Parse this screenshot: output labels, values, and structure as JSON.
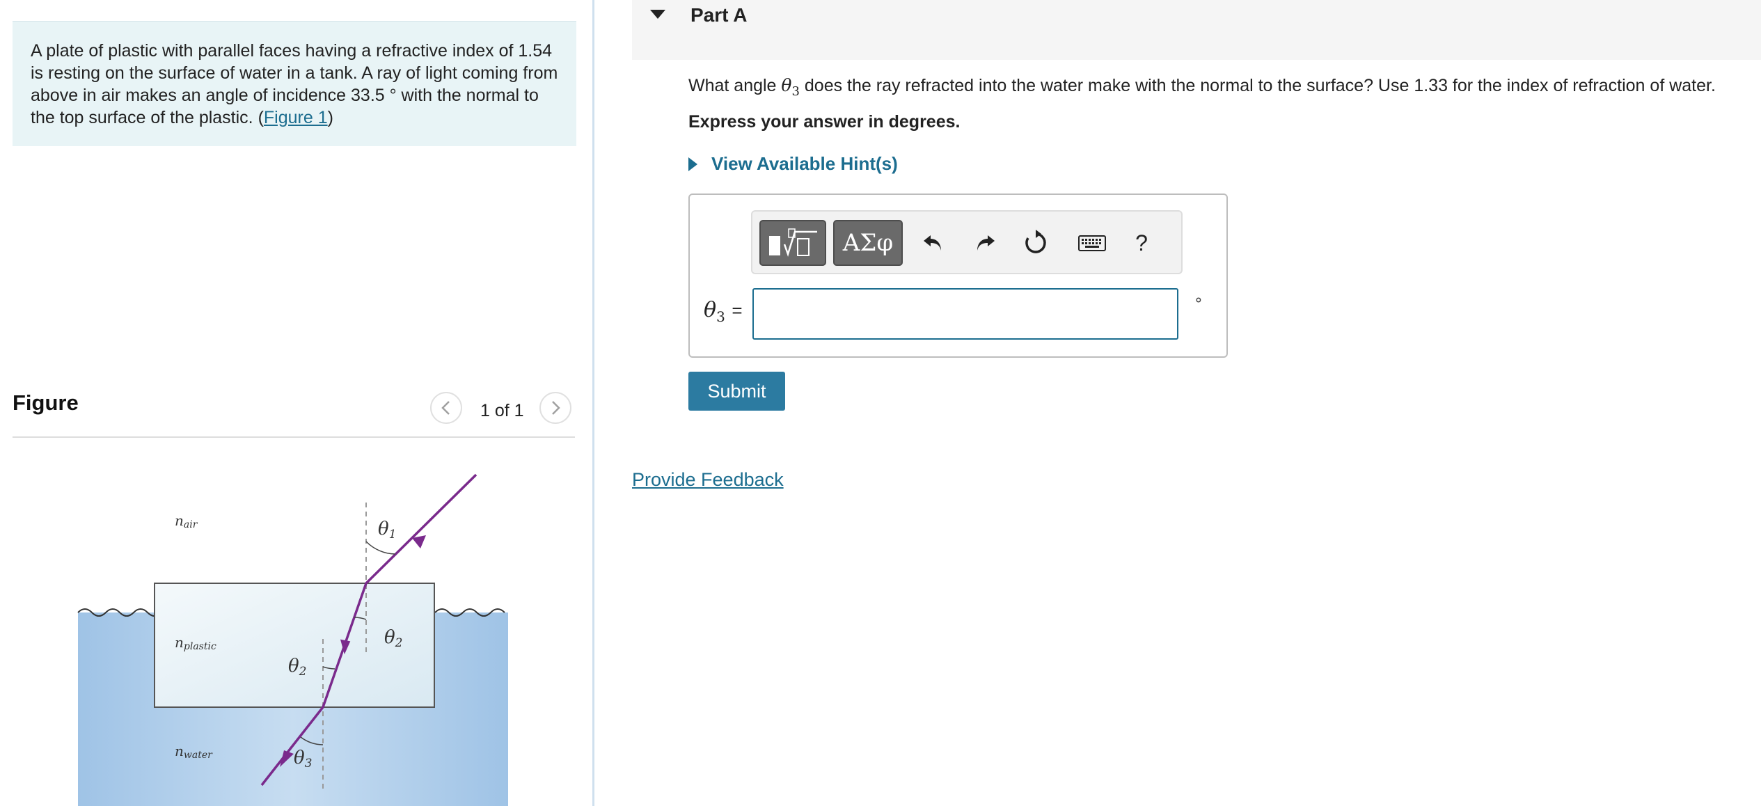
{
  "problem": {
    "text": "A plate of plastic with parallel faces having a refractive index of 1.54 is resting on the surface of water in a tank. A ray of light coming from above in air makes an angle of incidence 33.5 ° with the normal to the top surface of the plastic. (",
    "figure_link": "Figure 1",
    "close_paren": ")"
  },
  "figure": {
    "title": "Figure",
    "page_count": "1 of 1",
    "prev_icon": "chevron-left-icon",
    "next_icon": "chevron-right-icon",
    "labels": {
      "n_air": "n",
      "n_air_sub": "air",
      "n_plastic": "n",
      "n_plastic_sub": "plastic",
      "n_water": "n",
      "n_water_sub": "water",
      "theta1": "θ",
      "theta1_sub": "1",
      "theta2a": "θ",
      "theta2a_sub": "2",
      "theta2b": "θ",
      "theta2b_sub": "2",
      "theta3": "θ",
      "theta3_sub": "3"
    },
    "colors": {
      "ray": "#7a2a8c",
      "water": "#b6d3ec",
      "plastic": "#eaf3f7"
    }
  },
  "part": {
    "title": "Part A"
  },
  "question": {
    "pre": "What angle ",
    "theta": "θ",
    "theta_sub": "3",
    "post": " does the ray refracted into the water make with the normal to the surface? Use 1.33 for the index of refraction of water.",
    "express": "Express your answer in degrees."
  },
  "hints": {
    "label": "View Available Hint(s)"
  },
  "toolbar": {
    "greek": "ΑΣφ",
    "help": "?",
    "icons": [
      "templates-icon",
      "greek-icon",
      "undo-icon",
      "redo-icon",
      "reset-icon",
      "keyboard-icon",
      "help-icon"
    ]
  },
  "answer": {
    "var": "θ",
    "var_sub": "3",
    "equals": "=",
    "value": "",
    "unit": "∘"
  },
  "submit": {
    "label": "Submit"
  },
  "feedback": {
    "label": "Provide Feedback"
  },
  "colors": {
    "accent": "#1c6d8f",
    "submit": "#2c7ba1",
    "problem_bg": "#e8f4f6"
  }
}
